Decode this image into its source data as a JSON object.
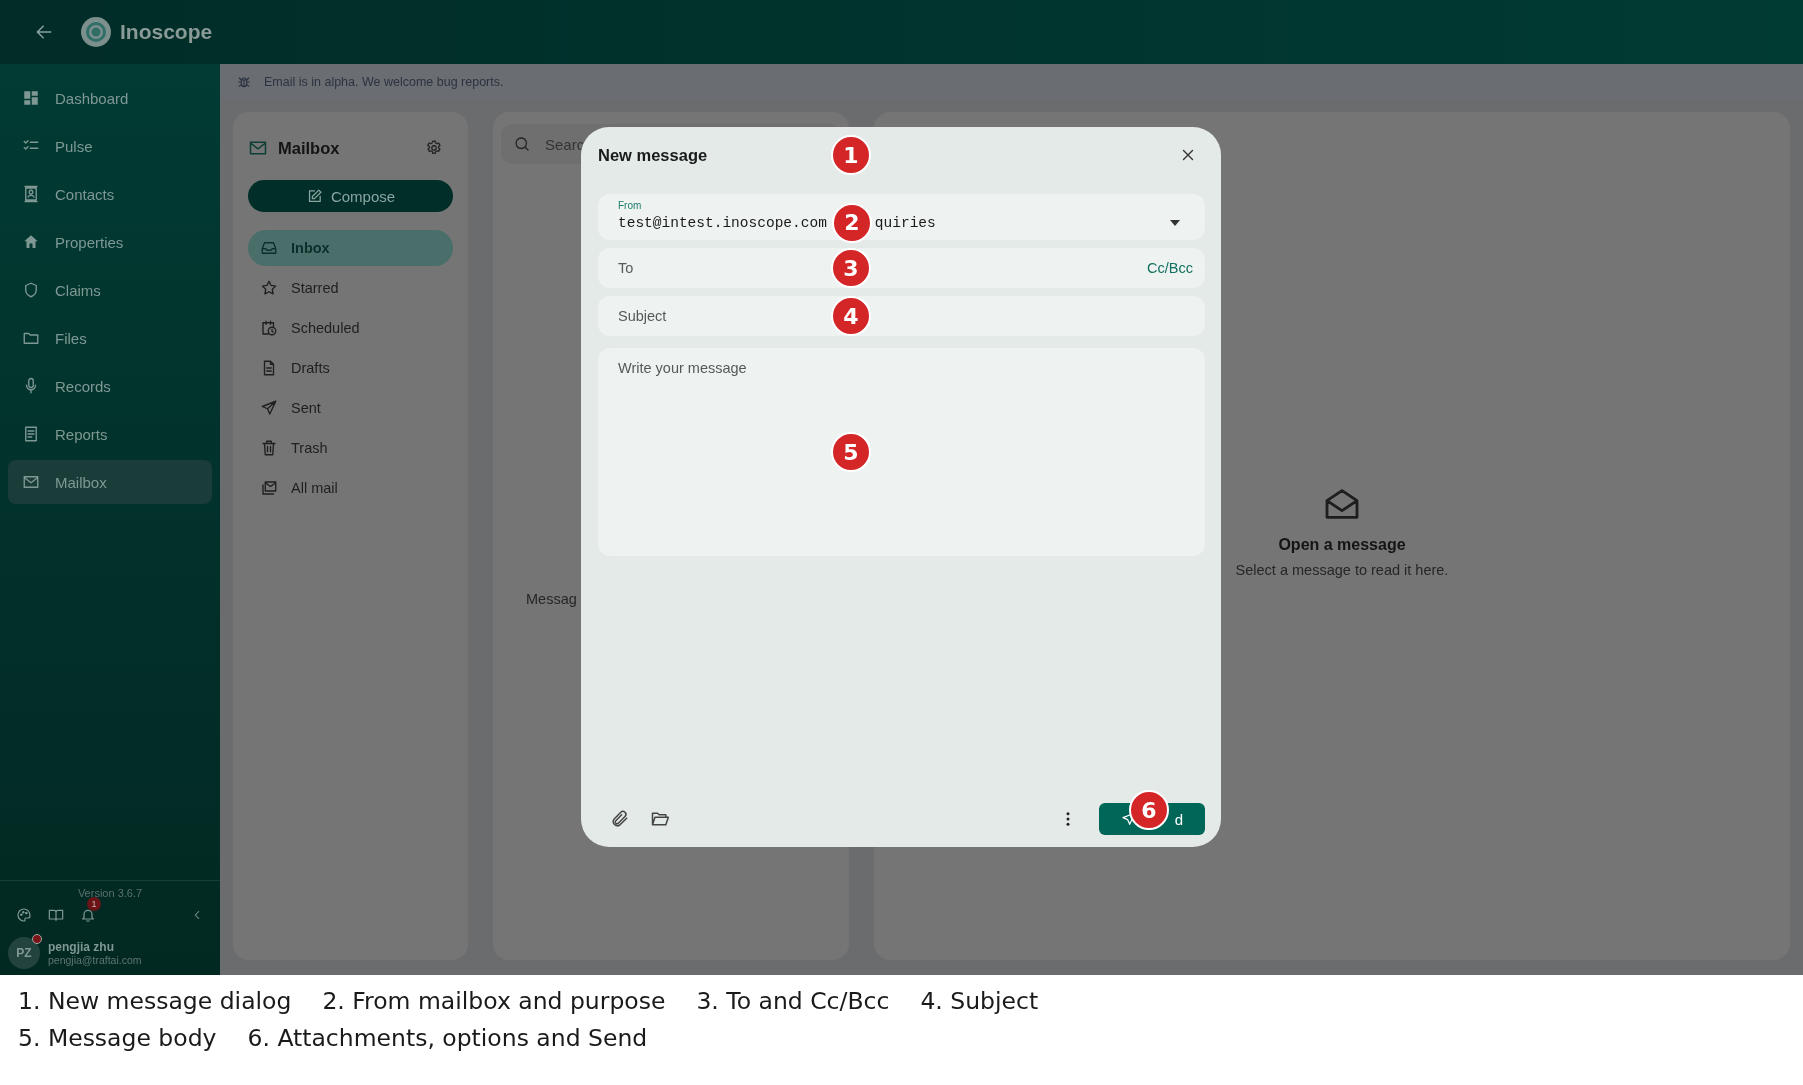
{
  "app": {
    "title": "Inoscope"
  },
  "nav": [
    {
      "label": "Dashboard",
      "kind": "dashboard",
      "selected": false
    },
    {
      "label": "Pulse",
      "kind": "checklist",
      "selected": false
    },
    {
      "label": "Contacts",
      "kind": "contacts",
      "selected": false
    },
    {
      "label": "Properties",
      "kind": "house",
      "selected": false
    },
    {
      "label": "Claims",
      "kind": "shield",
      "selected": false
    },
    {
      "label": "Files",
      "kind": "folder",
      "selected": false
    },
    {
      "label": "Records",
      "kind": "mic",
      "selected": false
    },
    {
      "label": "Reports",
      "kind": "report",
      "selected": false
    },
    {
      "label": "Mailbox",
      "kind": "mail",
      "selected": true
    }
  ],
  "sidebar_footer": {
    "version": "Version 3.6.7",
    "notifications": "1",
    "user": {
      "initials": "PZ",
      "name": "pengjia zhu",
      "email": "pengjia@traftai.com",
      "status_dot": true
    }
  },
  "alert": "Email is in alpha. We welcome bug reports.",
  "mailbox": {
    "title": "Mailbox",
    "compose": "Compose",
    "folders": [
      {
        "label": "Inbox",
        "kind": "inbox",
        "selected": true
      },
      {
        "label": "Starred",
        "kind": "star",
        "selected": false
      },
      {
        "label": "Scheduled",
        "kind": "scheduled",
        "selected": false
      },
      {
        "label": "Drafts",
        "kind": "draft",
        "selected": false
      },
      {
        "label": "Sent",
        "kind": "sent",
        "selected": false
      },
      {
        "label": "Trash",
        "kind": "trash",
        "selected": false
      },
      {
        "label": "All mail",
        "kind": "allmail",
        "selected": false
      }
    ]
  },
  "list": {
    "search_placeholder": "Searc",
    "empty": "Messag"
  },
  "reader": {
    "title": "Open a message",
    "hint": "Select a message to read it here."
  },
  "dialog": {
    "title": "New message",
    "marker": "1",
    "from": {
      "label": "From",
      "address": "test@intest.inoscope.com",
      "purpose": "quiries",
      "marker": "2"
    },
    "to": {
      "placeholder": "To",
      "cc_bcc": "Cc/Bcc",
      "marker": "3"
    },
    "subject": {
      "placeholder": "Subject",
      "marker": "4"
    },
    "body": {
      "placeholder": "Write your message",
      "marker": "5"
    },
    "send": {
      "label": "d",
      "marker": "6"
    }
  },
  "legend": [
    [
      "1. New message dialog",
      "2. From mailbox and purpose",
      "3. To and Cc/Bcc",
      "4. Subject"
    ],
    [
      "5. Message body",
      "6. Attachments, options and Send"
    ]
  ]
}
